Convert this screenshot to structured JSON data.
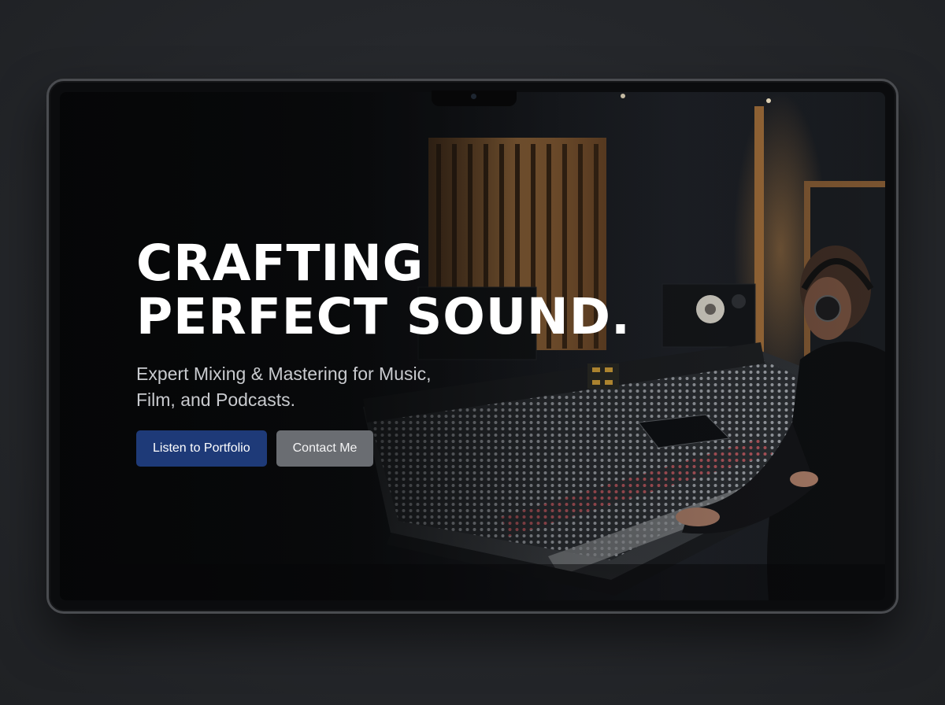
{
  "hero": {
    "headline_line1": "CRAFTING",
    "headline_line2": "PERFECT SOUND.",
    "subtitle": "Expert Mixing & Mastering for Music, Film, and Podcasts.",
    "primary_button": "Listen to Portfolio",
    "secondary_button": "Contact Me"
  },
  "colors": {
    "primary_button": "#1e3a78",
    "secondary_button": "#6a6d72",
    "headline": "#ffffff",
    "subtitle": "#c9cbcf",
    "background": "#25272b"
  },
  "scene": {
    "background_image": "recording-studio-mixing-console-engineer"
  }
}
